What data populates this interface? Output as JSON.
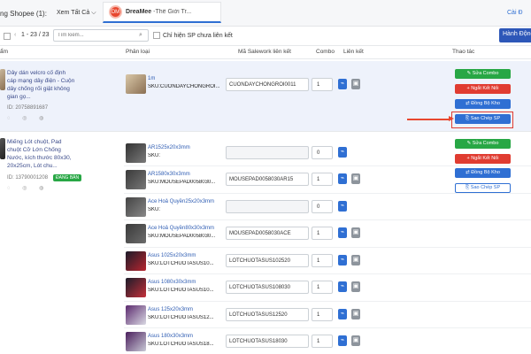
{
  "header": {
    "shop_title": "ng Shopee (1):",
    "view_all": "Xem Tất Cả",
    "chevron": "⌵",
    "shop_logo_text": "DM",
    "shop_brand": "DreaMee",
    "shop_tab_title": "-Thế Giới Tr...",
    "settings": "Cài Đ"
  },
  "toolbar": {
    "prev": "‹",
    "pager": "1 - 23 / 23",
    "next": "›",
    "search_placeholder": "Tìm kiếm...",
    "search_icon": "⌕",
    "only_unlinked_label": "Chỉ hiện SP chưa liên kết",
    "actions_button": "Hành Động"
  },
  "columns": {
    "product": "ẩm",
    "variant": "Phân loại",
    "salework_code": "Mã Salework liên kết",
    "combo": "Combo",
    "link": "Liên kết",
    "actions": "Thao tác"
  },
  "icons": {
    "link_icon": "⌁",
    "unlink_icon": "▣",
    "row_icons": "◌ ◎ ◍"
  },
  "products": [
    {
      "name": "Dây dán velcro cố định cáp mạng dây điện - Cuộn dây chống rối giật không gian gọ...",
      "id": "ID: 20758891687",
      "badge": "",
      "variants": [
        {
          "name": "1m",
          "sku": "SKU:CUONDAYCHONGROI...",
          "salework": "CUONDAYCHONGROI0011",
          "combo": "1"
        }
      ],
      "actions": {
        "edit_combo": "✎ Sửa Combo",
        "unlink": "+ Ngắt Kết Nối",
        "sync": "⇄ Đồng Bộ Kho",
        "copy": "⎘ Sao Chép SP"
      }
    },
    {
      "name": "Miếng Lót chuột, Pad chuột Cỡ Lớn Chống Nước, kích thước 80x30, 20x25cm, Lót chu...",
      "id": "ID: 13790001208",
      "badge": "ĐANG BÁN",
      "variants": [
        {
          "name": "AR1525x20x3mm",
          "sku": "SKU:",
          "salework": "",
          "combo": "0"
        },
        {
          "name": "AR1580x30x3mm",
          "sku": "SKU:MOUSEPAD0058030...",
          "salework": "MOUSEPAD0058030AR15",
          "combo": "1"
        },
        {
          "name": "Ace Hoả Quyền25x20x3mm",
          "sku": "SKU:",
          "salework": "",
          "combo": "0"
        },
        {
          "name": "Ace Hoả Quyền80x30x3mm",
          "sku": "SKU:MOUSEPAD0058030...",
          "salework": "MOUSEPAD0058030ACE",
          "combo": "1"
        },
        {
          "name": "Asus 1025x20x3mm",
          "sku": "SKU:LOTCHUOTASUS10...",
          "salework": "LOTCHUOTASUS102520",
          "combo": "1"
        },
        {
          "name": "Asus 1080x30x3mm",
          "sku": "SKU:LOTCHUOTASUS10...",
          "salework": "LOTCHUOTASUS108030",
          "combo": "1"
        },
        {
          "name": "Asus 125x20x3mm",
          "sku": "SKU:LOTCHUOTASUS12...",
          "salework": "LOTCHUOTASUS12520",
          "combo": "1"
        },
        {
          "name": "Asus 180x30x3mm",
          "sku": "SKU:LOTCHUOTASUS18...",
          "salework": "LOTCHUOTASUS18030",
          "combo": "1"
        }
      ],
      "actions": {
        "edit_combo": "✎ Sửa Combo",
        "unlink": "+ Ngắt Kết Nối",
        "sync": "⇄ Đồng Bộ Kho",
        "copy": "⎘ Sao Chép SP"
      }
    }
  ],
  "colors": {
    "primary": "#2f6fd3",
    "success": "#28a745",
    "danger": "#e03c31",
    "highlight": "#e8472f"
  }
}
